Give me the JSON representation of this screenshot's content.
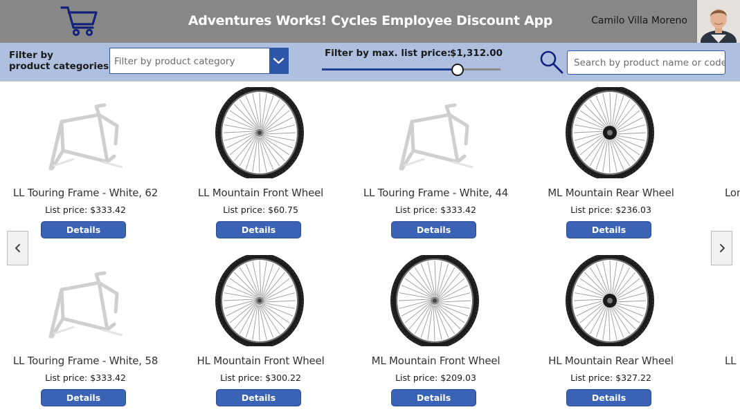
{
  "header": {
    "title": "Adventures Works! Cycles Employee Discount App",
    "user_name": "Camilo Villa Moreno",
    "cart_icon": "shopping-cart-icon",
    "avatar": "user-photo"
  },
  "filters": {
    "category_label_line1": "Filter by",
    "category_label_line2": "product categories:",
    "category_placeholder": "Filter by product category",
    "price_label": "Filter by max. list price:",
    "price_value": "$1,312.00",
    "price_slider_fraction": 0.76,
    "search_placeholder": "Search by product name or code"
  },
  "gallery": {
    "details_label": "Details",
    "price_prefix": "List price: ",
    "products": [
      {
        "name": "LL Touring Frame - White, 62",
        "price": "List price: $333.42",
        "image": "frame"
      },
      {
        "name": "LL Mountain Front Wheel",
        "price": "List price: $60.75",
        "image": "front-wheel"
      },
      {
        "name": "LL Touring Frame - White, 44",
        "price": "List price: $333.42",
        "image": "frame"
      },
      {
        "name": "ML Mountain Rear Wheel",
        "price": "List price: $236.03",
        "image": "rear-wheel"
      },
      {
        "name": "Lon",
        "price": "",
        "image": "none"
      },
      {
        "name": "LL Touring Frame - White, 58",
        "price": "List price: $333.42",
        "image": "frame"
      },
      {
        "name": "HL Mountain Front Wheel",
        "price": "List price: $300.22",
        "image": "front-wheel"
      },
      {
        "name": "ML Mountain Front Wheel",
        "price": "List price: $209.03",
        "image": "front-wheel"
      },
      {
        "name": "HL Mountain Rear Wheel",
        "price": "List price: $327.22",
        "image": "rear-wheel"
      },
      {
        "name": "LL",
        "price": "",
        "image": "none"
      }
    ]
  },
  "nav": {
    "prev_icon": "chevron-left-icon",
    "next_icon": "chevron-right-icon"
  },
  "colors": {
    "header_bg": "#878787",
    "filterbar_bg": "#aebfe0",
    "accent": "#2d55a8",
    "button": "#3a62b5"
  }
}
